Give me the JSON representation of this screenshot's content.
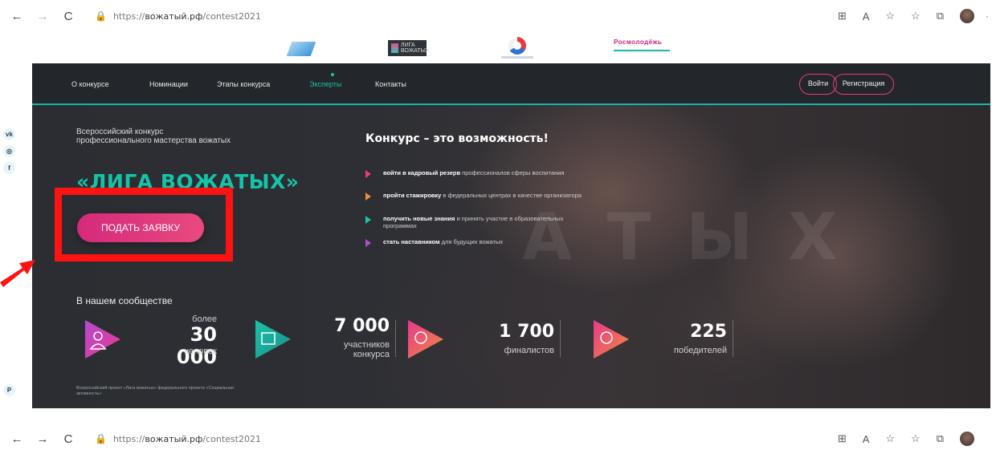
{
  "browser": {
    "url_prefix": "https://",
    "url_host": "вожатый.рф",
    "url_path": "/contest2021",
    "back": "←",
    "forward": "→",
    "reload": "C",
    "lock": "🔒",
    "tools": [
      "⊞",
      "A",
      "☆",
      "☆",
      "⧉"
    ],
    "more": "·"
  },
  "logos": {
    "partner_small_text": "ЛИГА ВОЖАТЫХ",
    "rosmolodezh": "Росмолодёжь"
  },
  "nav": {
    "items": [
      "О конкурсе",
      "Номинации",
      "Этапы конкурса",
      "Эксперты",
      "Контакты"
    ],
    "active": "Эксперты",
    "login": "Войти",
    "register": "Регистрация"
  },
  "social": {
    "vk": "vk",
    "instagram": "◎",
    "facebook": "f",
    "p": "P"
  },
  "hero": {
    "subtitle": "Всероссийский конкурс профессионального мастерства вожатых",
    "title": "«ЛИГА ВОЖАТЫХ»",
    "watermark": "А Т Ы Х",
    "apply_button": "ПОДАТЬ ЗАЯВКУ",
    "community_heading": "В нашем сообществе",
    "footer": "Всероссийский проект «Лига вожатых» федерального проекта «Социальная активность»"
  },
  "opportunities": {
    "heading": "Конкурс – это возможность!",
    "items": [
      {
        "bold": "войти в кадровый резерв",
        "rest": " профессионалов сферы воспитания",
        "color": "#e83c83"
      },
      {
        "bold": "пройти стажировку",
        "rest": " в федеральных центрах в качестве организатора",
        "color": "#f08a3e"
      },
      {
        "bold": "получить новые знания",
        "rest": " и принять участие в образовательных программах",
        "color": "#19c3a8"
      },
      {
        "bold": "стать наставником",
        "rest": " для будущих вожатых",
        "color": "#b44ad0"
      }
    ]
  },
  "stats": [
    {
      "top": "более",
      "number": "30 000",
      "bottom": "человек"
    },
    {
      "number": "7 000",
      "bottom": "участников конкурса"
    },
    {
      "number": "1 700",
      "bottom": "финалистов"
    },
    {
      "number": "225",
      "bottom": "победителей"
    }
  ],
  "colors": {
    "accent_teal": "#15c3a8",
    "accent_pink": "#e83c83",
    "highlight_red": "#ff1212"
  }
}
